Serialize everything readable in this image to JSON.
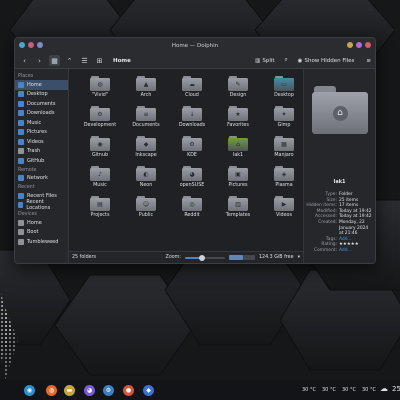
{
  "window": {
    "title": "Home — Dolphin",
    "title_buttons": [
      {
        "name": "minimize",
        "color": "#c9a54a"
      },
      {
        "name": "maximize",
        "color": "#b56ad0"
      },
      {
        "name": "close",
        "color": "#d65a6b"
      }
    ],
    "left_buttons": [
      {
        "name": "app-menu",
        "color": "#4aa8d0"
      },
      {
        "name": "pin",
        "color": "#c95b85"
      },
      {
        "name": "keep-above",
        "color": "#7e8ad0"
      }
    ]
  },
  "toolbar": {
    "breadcrumb": "Home",
    "split_label": "Split",
    "show_hidden_label": "Show Hidden Files"
  },
  "sidebar": {
    "sections": [
      {
        "title": "Places",
        "items": [
          {
            "label": "Home",
            "icon": "home-icon",
            "color": "#4b83c7",
            "selected": true
          },
          {
            "label": "Desktop",
            "icon": "desktop-icon",
            "color": "#4b83c7"
          },
          {
            "label": "Documents",
            "icon": "documents-icon",
            "color": "#4b83c7"
          },
          {
            "label": "Downloads",
            "icon": "downloads-icon",
            "color": "#4b83c7"
          },
          {
            "label": "Music",
            "icon": "music-icon",
            "color": "#4b83c7"
          },
          {
            "label": "Pictures",
            "icon": "pictures-icon",
            "color": "#4b83c7"
          },
          {
            "label": "Videos",
            "icon": "videos-icon",
            "color": "#4b83c7"
          },
          {
            "label": "Trash",
            "icon": "trash-icon",
            "color": "#8e9297"
          },
          {
            "label": "GitHub",
            "icon": "github-icon",
            "color": "#4b83c7"
          }
        ]
      },
      {
        "title": "Remote",
        "items": [
          {
            "label": "Network",
            "icon": "network-icon",
            "color": "#4b83c7"
          }
        ]
      },
      {
        "title": "Recent",
        "items": [
          {
            "label": "Recent Files",
            "icon": "recent-files-icon",
            "color": "#4b83c7"
          },
          {
            "label": "Recent Locations",
            "icon": "recent-locations-icon",
            "color": "#4b83c7"
          }
        ]
      },
      {
        "title": "Devices",
        "items": [
          {
            "label": "Home",
            "icon": "drive-icon",
            "color": "#8e9297"
          },
          {
            "label": "Boot",
            "icon": "drive-icon",
            "color": "#8e9297"
          },
          {
            "label": "Tumbleweed",
            "icon": "drive-icon",
            "color": "#8e9297"
          }
        ]
      }
    ]
  },
  "files": [
    {
      "name": "\"Vivid\"",
      "glyph": "◍"
    },
    {
      "name": "Arch",
      "glyph": "▲"
    },
    {
      "name": "Cloud",
      "glyph": "☁"
    },
    {
      "name": "Design",
      "glyph": "✎"
    },
    {
      "name": "Desktop",
      "glyph": "▭",
      "tint": "#3f8fa8"
    },
    {
      "name": "Development",
      "glyph": "⚙"
    },
    {
      "name": "Documents",
      "glyph": "≡"
    },
    {
      "name": "Downloads",
      "glyph": "↓"
    },
    {
      "name": "Favorites",
      "glyph": "★"
    },
    {
      "name": "Gimp",
      "glyph": "✦"
    },
    {
      "name": "Gitnub",
      "glyph": "◉"
    },
    {
      "name": "Inkscape",
      "glyph": "◆"
    },
    {
      "name": "KDE",
      "glyph": "⚙"
    },
    {
      "name": "Iak1",
      "glyph": "⌂",
      "tint": "#6fa03a"
    },
    {
      "name": "Manjaro",
      "glyph": "▦"
    },
    {
      "name": "Music",
      "glyph": "♪"
    },
    {
      "name": "Neon",
      "glyph": "◐"
    },
    {
      "name": "openSUSE",
      "glyph": "◕"
    },
    {
      "name": "Pictures",
      "glyph": "▣"
    },
    {
      "name": "Plasma",
      "glyph": "◈"
    },
    {
      "name": "Projects",
      "glyph": "▤"
    },
    {
      "name": "Public",
      "glyph": "☺"
    },
    {
      "name": "Reddit",
      "glyph": "◎"
    },
    {
      "name": "Templates",
      "glyph": "▥"
    },
    {
      "name": "Videos",
      "glyph": "▶"
    }
  ],
  "statusbar": {
    "count": "25 folders",
    "zoom_label": "Zoom:",
    "zoom_level": 0.42,
    "free_space": "124.3 GiB free",
    "used_fraction": 0.55
  },
  "info_panel": {
    "title": "Iak1",
    "properties": [
      {
        "key": "Type:",
        "value": "Folder"
      },
      {
        "key": "Size:",
        "value": "25 items"
      },
      {
        "key": "Hidden items:",
        "value": "17 items"
      },
      {
        "key": "Modified:",
        "value": "Today at 19:42"
      },
      {
        "key": "Accessed:",
        "value": "Today at 19:42"
      },
      {
        "key": "Created:",
        "value": "Monday, 22 January 2024 at 21:46"
      },
      {
        "key": "Tags:",
        "value": "Add..."
      },
      {
        "key": "Rating:",
        "value": "★★★★★"
      },
      {
        "key": "Comment:",
        "value": "Add..."
      }
    ]
  },
  "taskbar": {
    "apps": [
      {
        "name": "app-launcher-icon",
        "color": "#2b8fd6",
        "glyph": "◉"
      },
      {
        "name": "firefox-icon",
        "color": "#e36a2a",
        "glyph": "◍"
      },
      {
        "name": "dolphin-icon",
        "color": "#c4a73a",
        "glyph": "▬"
      },
      {
        "name": "discord-icon",
        "color": "#7a5cd6",
        "glyph": "◕"
      },
      {
        "name": "settings-icon",
        "color": "#3a7fc4",
        "glyph": "⚙"
      },
      {
        "name": "browser-icon",
        "color": "#d6553a",
        "glyph": "●"
      },
      {
        "name": "app-icon",
        "color": "#3a6fd6",
        "glyph": "◆"
      }
    ],
    "temp1": "30 °C",
    "temp2": "30 °C",
    "temp3": "30 °C",
    "temp4": "30 °C",
    "weather_temp": "25"
  }
}
